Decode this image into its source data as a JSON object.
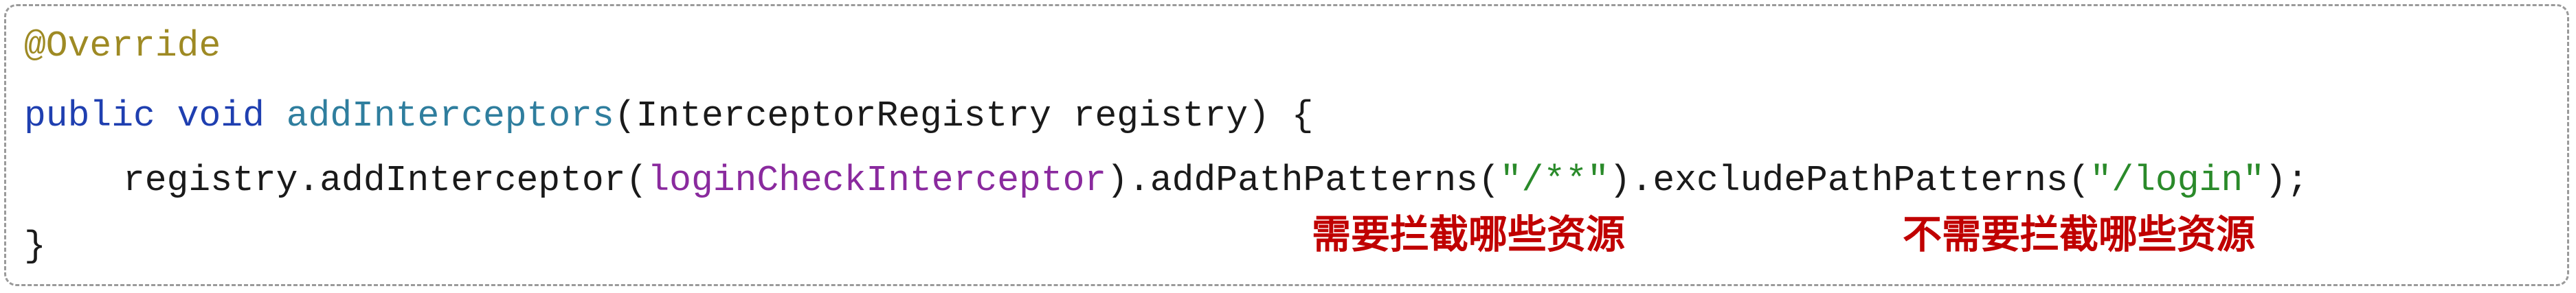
{
  "colors": {
    "annotation": "#9e8a24",
    "keyword": "#1f3fb0",
    "method": "#2f7e9e",
    "plain": "#1a1a1a",
    "field": "#8a2a9e",
    "string": "#2a8a2a",
    "note": "#c00000",
    "border": "#9a9a9a"
  },
  "code": {
    "line1": {
      "annotation": "@Override"
    },
    "line2": {
      "kw_public": "public",
      "kw_void": "void",
      "method_name": "addInterceptors",
      "signature": "(InterceptorRegistry registry) {"
    },
    "line3": {
      "receiver": "registry.addInterceptor(",
      "field": "loginCheckInterceptor",
      "call_patterns": ").addPathPatterns(",
      "include_pattern": "\"/**\"",
      "call_exclude": ").excludePathPatterns(",
      "exclude_pattern": "\"/login\"",
      "end": ");"
    },
    "line4": {
      "closing": "}"
    }
  },
  "annotations": {
    "include_note": "需要拦截哪些资源",
    "exclude_note": "不需要拦截哪些资源"
  }
}
